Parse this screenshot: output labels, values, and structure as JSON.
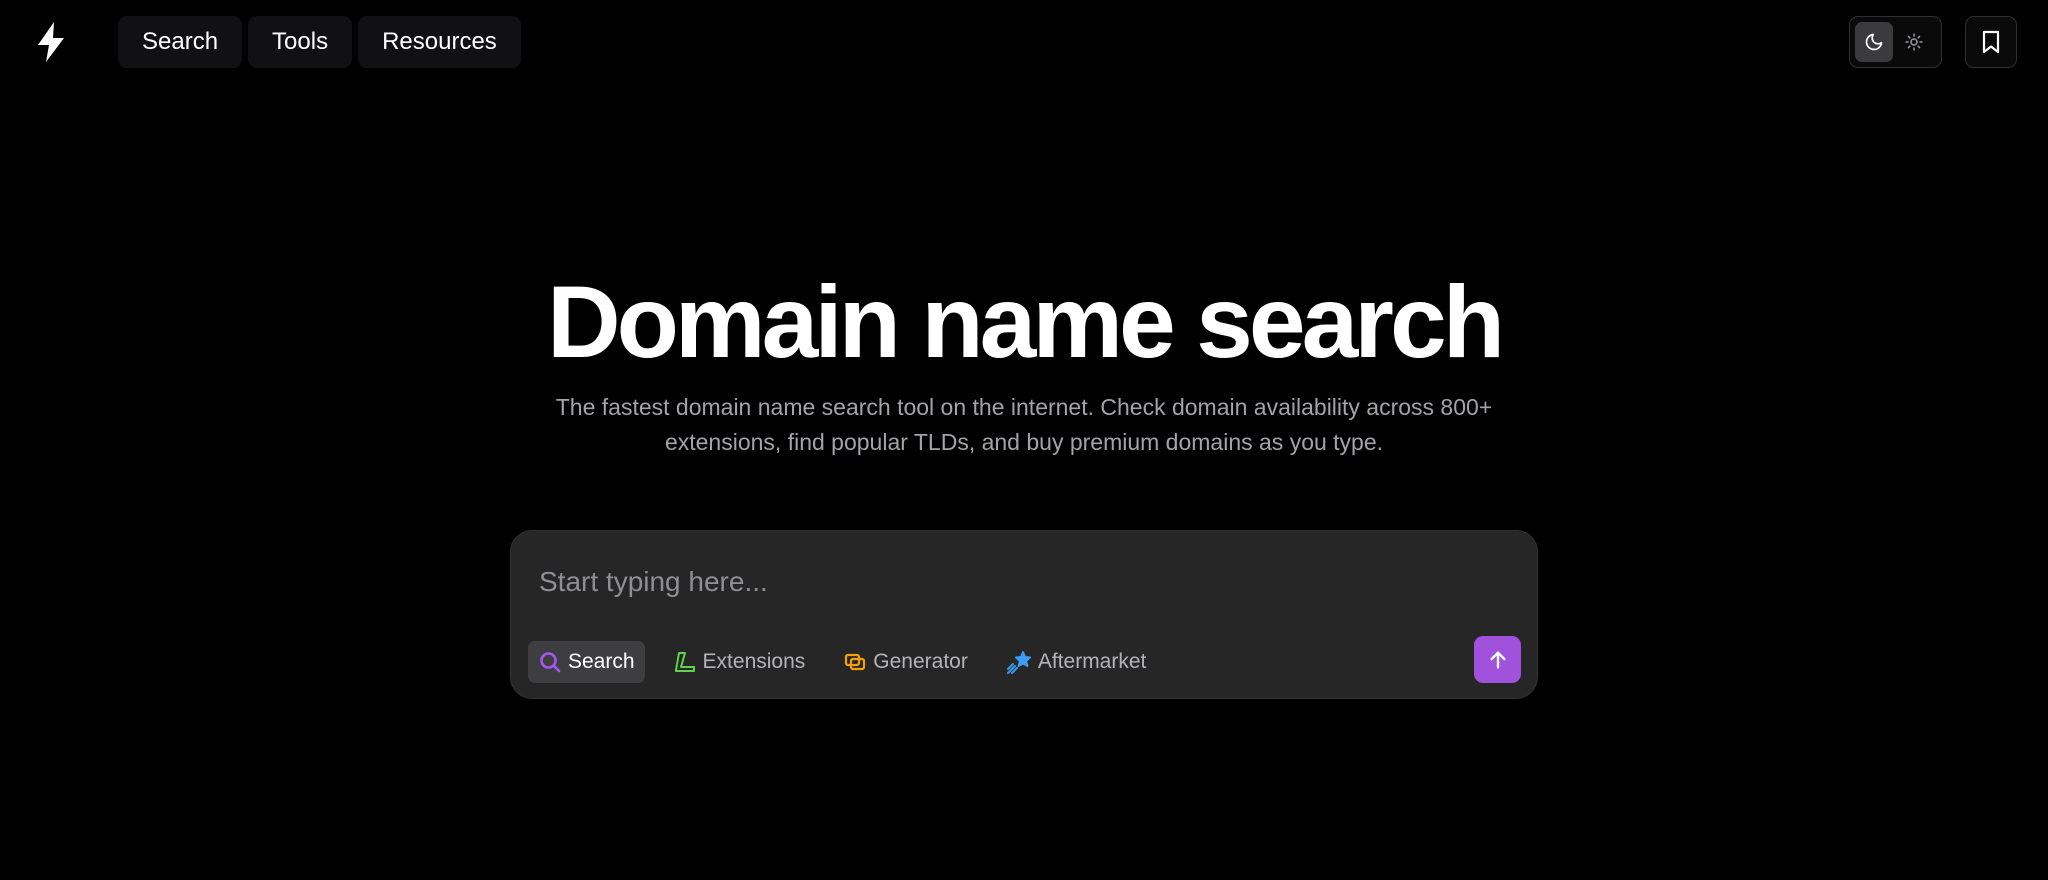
{
  "nav": {
    "items": [
      {
        "label": "Search"
      },
      {
        "label": "Tools"
      },
      {
        "label": "Resources"
      }
    ]
  },
  "hero": {
    "title": "Domain name search",
    "subtitle_line1": "The fastest domain name search tool on the internet. Check domain availability across 800+",
    "subtitle_line2": "extensions, find popular TLDs, and buy premium domains as you type."
  },
  "search": {
    "placeholder": "Start typing here...",
    "value": "",
    "modes": [
      {
        "label": "Search",
        "icon": "search-icon",
        "color": "#a855f7",
        "active": true
      },
      {
        "label": "Extensions",
        "icon": "extensions-icon",
        "color": "#5fd34a",
        "active": false
      },
      {
        "label": "Generator",
        "icon": "generator-icon",
        "color": "#f59e0b",
        "active": false
      },
      {
        "label": "Aftermarket",
        "icon": "aftermarket-icon",
        "color": "#3b9cf5",
        "active": false
      }
    ],
    "submit_icon": "arrow-up-icon"
  },
  "colors": {
    "background": "#000000",
    "accent": "#a052dc",
    "panel": "#262626"
  },
  "theme": {
    "active": "dark"
  }
}
